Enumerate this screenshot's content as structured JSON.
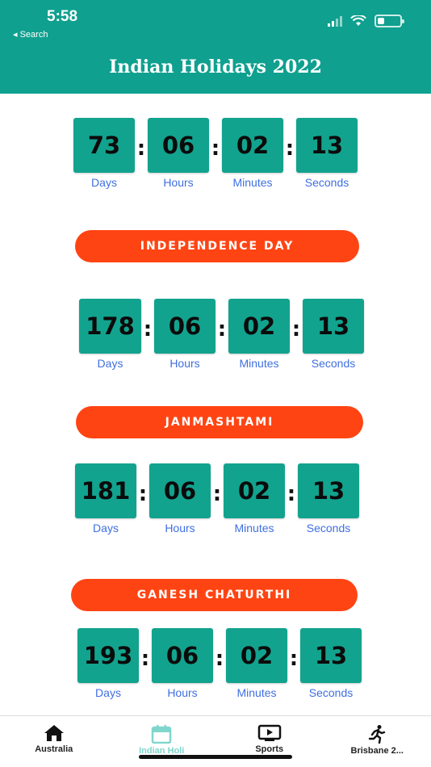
{
  "status_bar": {
    "time": "5:58",
    "back_label": "◂ Search"
  },
  "header": {
    "title": "Indian Holidays 2022"
  },
  "unit_labels": {
    "days": "Days",
    "hours": "Hours",
    "minutes": "Minutes",
    "seconds": "Seconds"
  },
  "countdowns": [
    {
      "title": "",
      "days": "73",
      "hours": "06",
      "minutes": "02",
      "seconds": "13"
    },
    {
      "title": "INDEPENDENCE DAY",
      "days": "178",
      "hours": "06",
      "minutes": "02",
      "seconds": "13"
    },
    {
      "title": "JANMASHTAMI",
      "days": "181",
      "hours": "06",
      "minutes": "02",
      "seconds": "13"
    },
    {
      "title": "GANESH CHATURTHI",
      "days": "193",
      "hours": "06",
      "minutes": "02",
      "seconds": "13"
    }
  ],
  "tabs": [
    {
      "label": "Australia",
      "icon": "home-icon"
    },
    {
      "label": "Indian Holi",
      "icon": "calendar-icon",
      "active": true
    },
    {
      "label": "Sports",
      "icon": "tv-icon"
    },
    {
      "label": "Brisbane 2...",
      "icon": "runner-icon"
    }
  ],
  "colors": {
    "primary": "#0fa08f",
    "accent": "#ff4413",
    "label": "#3f6fe0"
  }
}
